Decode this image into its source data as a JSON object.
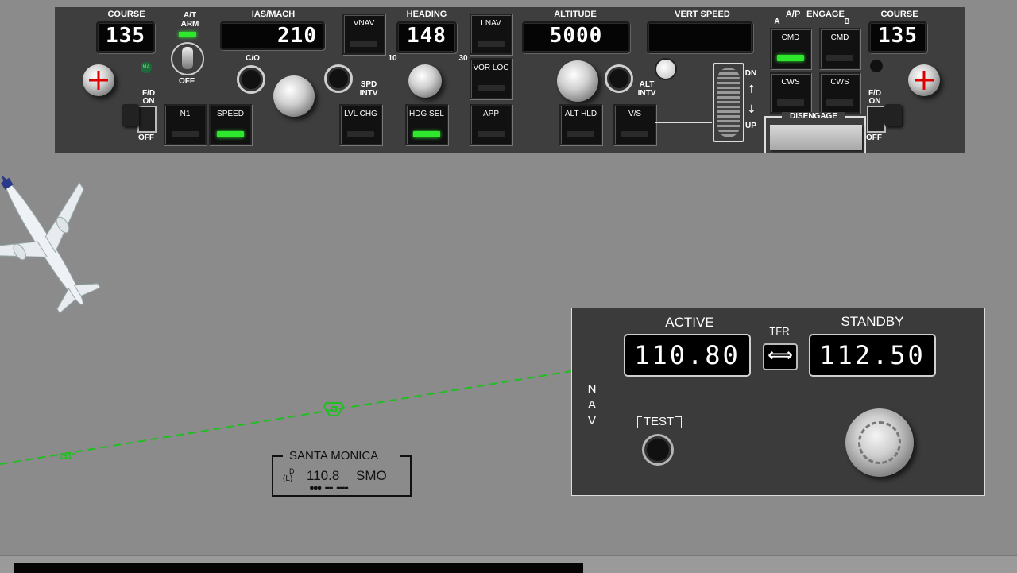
{
  "mcp": {
    "course_left": {
      "label": "COURSE",
      "value": "135"
    },
    "autothrottle": {
      "label": "A/T",
      "arm_label": "ARM",
      "off_label": "OFF",
      "indicator": "MA"
    },
    "ias_mach": {
      "label": "IAS/MACH",
      "value": "210",
      "co_label": "C/O",
      "spd_intv_label1": "SPD",
      "spd_intv_label2": "INTV"
    },
    "vnav": {
      "label": "VNAV"
    },
    "heading": {
      "label": "HEADING",
      "value": "148",
      "bank_min": "10",
      "bank_max": "30"
    },
    "lnav": {
      "label": "LNAV"
    },
    "vorloc": {
      "label": "VOR LOC"
    },
    "app": {
      "label": "APP"
    },
    "altitude": {
      "label": "ALTITUDE",
      "value": "5000",
      "alt_intv1": "ALT",
      "alt_intv2": "INTV"
    },
    "vert_speed": {
      "label": "VERT SPEED",
      "value": ""
    },
    "ap_engage": {
      "label_ap": "A/P",
      "label_engage": "ENGAGE",
      "a": "A",
      "b": "B",
      "cmd_a": "CMD",
      "cmd_b": "CMD",
      "cws_a": "CWS",
      "cws_b": "CWS"
    },
    "course_right": {
      "label": "COURSE",
      "value": "135"
    },
    "fd_left": {
      "label": "F/D",
      "on": "ON",
      "off": "OFF"
    },
    "fd_right": {
      "label": "F/D",
      "on": "ON",
      "off": "OFF"
    },
    "n1": {
      "label": "N1"
    },
    "speed": {
      "label": "SPEED"
    },
    "lvlchg": {
      "label": "LVL CHG"
    },
    "hdgsel": {
      "label": "HDG SEL"
    },
    "althld": {
      "label": "ALT HLD"
    },
    "vs": {
      "label": "V/S"
    },
    "vs_wheel": {
      "dn": "DN",
      "up": "UP"
    },
    "disengage": {
      "label": "DISENGAGE"
    },
    "lights_on": [
      "cmd_a",
      "speed",
      "hdg_sel",
      "at_arm"
    ]
  },
  "nav_radio": {
    "side_label": "NAV",
    "active_label": "ACTIVE",
    "active_freq": "110.80",
    "tfr_label": "TFR",
    "tfr_glyph": "⟺",
    "standby_label": "STANDBY",
    "standby_freq": "112.50",
    "test_label": "TEST"
  },
  "map": {
    "radial_label": "261°",
    "vor_name": "SANTA MONICA",
    "vor_class_d": "D",
    "vor_class_l": "(L)",
    "vor_freq": "110.8",
    "vor_id": "SMO",
    "route_color": "#1fbf1f"
  },
  "colors": {
    "light_on": "#2ee82e",
    "panel": "#3e3e3e",
    "background": "#8b8b8b"
  }
}
